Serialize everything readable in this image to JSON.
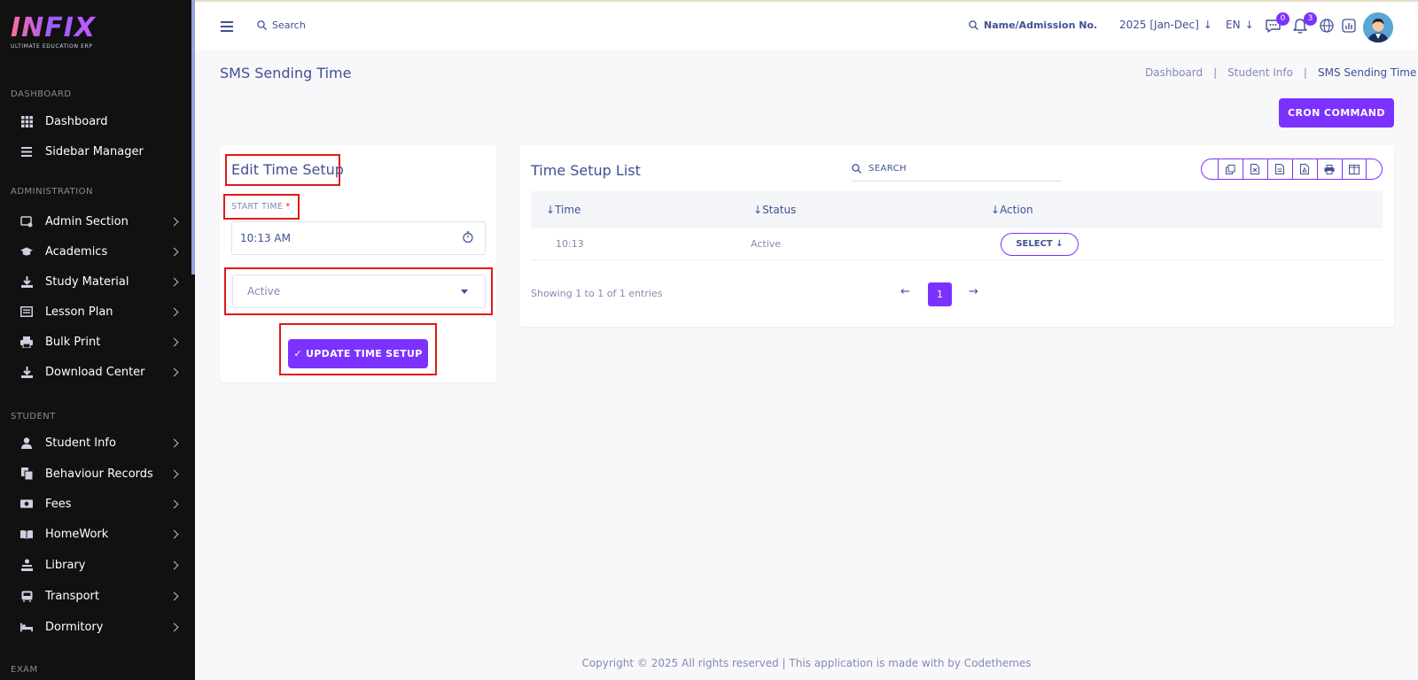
{
  "sidebar": {
    "logo": "INFIX",
    "logo_sub": "ULTIMATE EDUCATION ERP",
    "sections": {
      "dashboard": "DASHBOARD",
      "administration": "ADMINISTRATION",
      "student": "STUDENT",
      "exam": "EXAM"
    },
    "items": [
      {
        "label": "Dashboard"
      },
      {
        "label": "Sidebar Manager"
      },
      {
        "label": "Admin Section"
      },
      {
        "label": "Academics"
      },
      {
        "label": "Study Material"
      },
      {
        "label": "Lesson Plan"
      },
      {
        "label": "Bulk Print"
      },
      {
        "label": "Download Center"
      },
      {
        "label": "Student Info"
      },
      {
        "label": "Behaviour Records"
      },
      {
        "label": "Fees"
      },
      {
        "label": "HomeWork"
      },
      {
        "label": "Library"
      },
      {
        "label": "Transport"
      },
      {
        "label": "Dormitory"
      }
    ]
  },
  "header": {
    "search_label": "Search",
    "name_search_label": "Name/Admission No.",
    "year": "2025 [Jan-Dec]",
    "lang": "EN",
    "messages_count": "0",
    "notifications_count": "3"
  },
  "page": {
    "title": "SMS Sending Time",
    "breadcrumb": [
      "Dashboard",
      "Student Info",
      "SMS Sending Time"
    ],
    "breadcrumb_sep": "|",
    "cron_button": "CRON COMMAND"
  },
  "edit_form": {
    "title": "Edit Time Setup",
    "start_time_label": "START TIME",
    "required_mark": "*",
    "start_time_value": "10:13 AM",
    "status_value": "Active",
    "submit_label": "UPDATE TIME SETUP",
    "submit_check": "✓"
  },
  "list": {
    "title": "Time Setup List",
    "search_label": "SEARCH",
    "columns": [
      "Time",
      "Status",
      "Action"
    ],
    "rows": [
      {
        "time": "10:13",
        "status": "Active",
        "action": "SELECT"
      }
    ],
    "entries_text": "Showing 1 to 1 of 1 entries",
    "current_page": "1"
  },
  "footer": {
    "text": "Copyright © 2025 All rights reserved | This application is made with by Codethemes"
  },
  "colors": {
    "accent": "#7c32ff",
    "text": "#415094",
    "highlight": "#e01a1a"
  }
}
